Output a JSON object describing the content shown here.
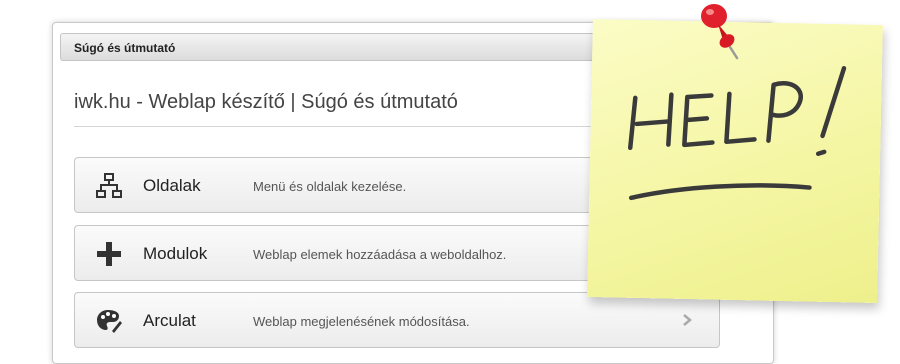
{
  "panel": {
    "header_title": "Súgó és útmutató",
    "page_title": "iwk.hu - Weblap készítő | Súgó és útmutató"
  },
  "menu": [
    {
      "icon": "sitemap-icon",
      "label": "Oldalak",
      "description": "Menü és oldalak kezelése."
    },
    {
      "icon": "plus-icon",
      "label": "Modulok",
      "description": "Weblap elemek hozzáadása a weboldalhoz."
    },
    {
      "icon": "palette-icon",
      "label": "Arculat",
      "description": "Weblap megjelenésének módosítása."
    }
  ],
  "sticky_note": {
    "text": "HELP!",
    "color": "#f5f6a4",
    "pin_color": "#e0202c"
  }
}
